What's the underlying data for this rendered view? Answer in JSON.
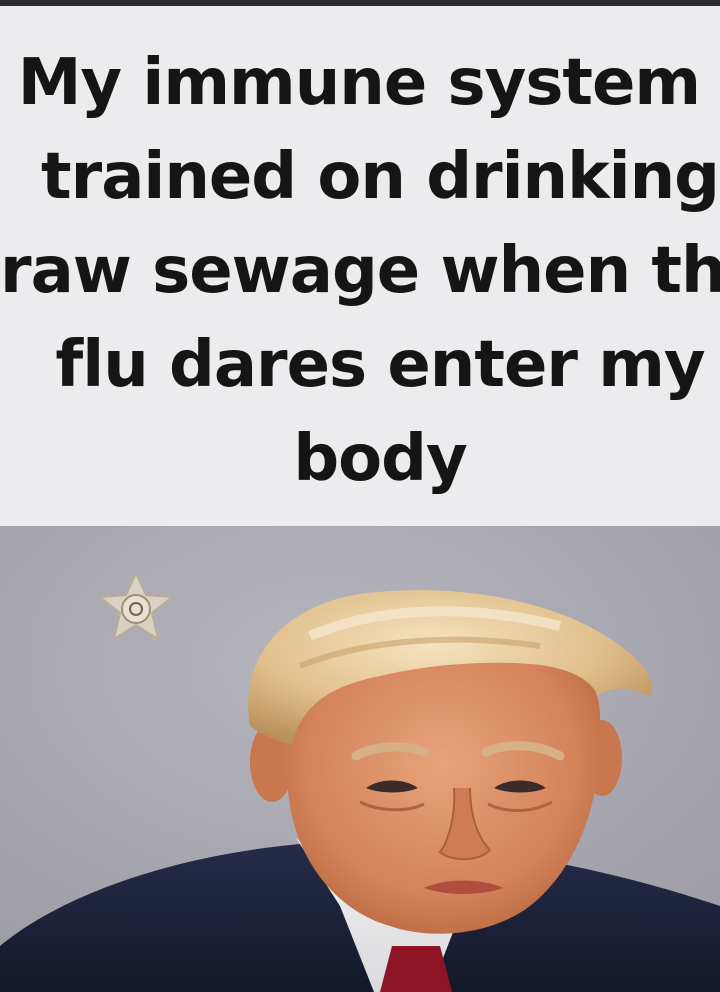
{
  "meme": {
    "caption_lines": [
      "My immune system i",
      "trained on drinking",
      "raw sewage when the",
      "flu dares enter my",
      "body"
    ],
    "photo": {
      "kind": "mugshot-portrait",
      "background_color": "#a9a8b0",
      "hair_color": "#e2c596",
      "suit_color": "#1c2238",
      "tie_color": "#8e1526",
      "badge_icon": "sheriff-badge-icon"
    }
  }
}
